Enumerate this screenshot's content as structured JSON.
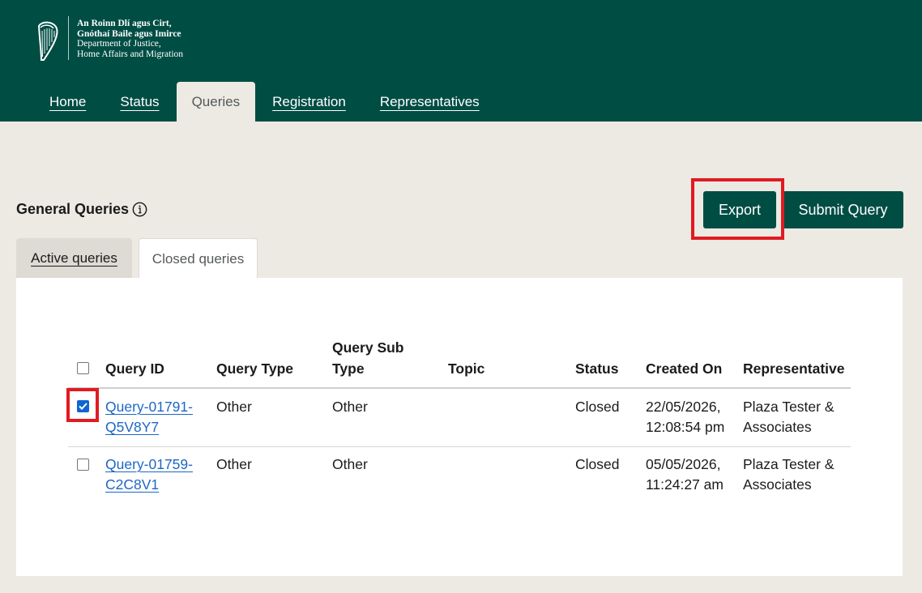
{
  "header": {
    "dept_lines": [
      "An Roinn Dlí agus Cirt,",
      "Gnóthaí Baile agus Imirce",
      "Department of Justice,",
      "Home Affairs and Migration"
    ],
    "nav": [
      {
        "label": "Home",
        "active": false
      },
      {
        "label": "Status",
        "active": false
      },
      {
        "label": "Queries",
        "active": true
      },
      {
        "label": "Registration",
        "active": false
      },
      {
        "label": "Representatives",
        "active": false
      }
    ]
  },
  "page": {
    "title": "General Queries",
    "export_label": "Export",
    "submit_label": "Submit Query",
    "tabs": [
      {
        "label": "Active queries",
        "selected": false
      },
      {
        "label": "Closed queries",
        "selected": true
      }
    ]
  },
  "table": {
    "columns": [
      "Query ID",
      "Query Type",
      "Query Sub Type",
      "Topic",
      "Status",
      "Created On",
      "Representative"
    ],
    "column_lines": {
      "subtype": [
        "Query Sub",
        "Type"
      ]
    },
    "rows": [
      {
        "checked": true,
        "id_lines": [
          "Query-01791-",
          "Q5V8Y7"
        ],
        "type": "Other",
        "subtype": "Other",
        "topic": "",
        "status": "Closed",
        "created_lines": [
          "22/05/2026,",
          "12:08:54 pm"
        ],
        "rep_lines": [
          "Plaza Tester &",
          "Associates"
        ]
      },
      {
        "checked": false,
        "id_lines": [
          "Query-01759-",
          "C2C8V1"
        ],
        "type": "Other",
        "subtype": "Other",
        "topic": "",
        "status": "Closed",
        "created_lines": [
          "05/05/2026,",
          "11:24:27 am"
        ],
        "rep_lines": [
          "Plaza Tester &",
          "Associates"
        ]
      }
    ]
  },
  "colors": {
    "brand": "#004d44",
    "background": "#eceae2",
    "link": "#1d67c5",
    "highlight": "#e01b22",
    "checkbox": "#0f66d0"
  }
}
